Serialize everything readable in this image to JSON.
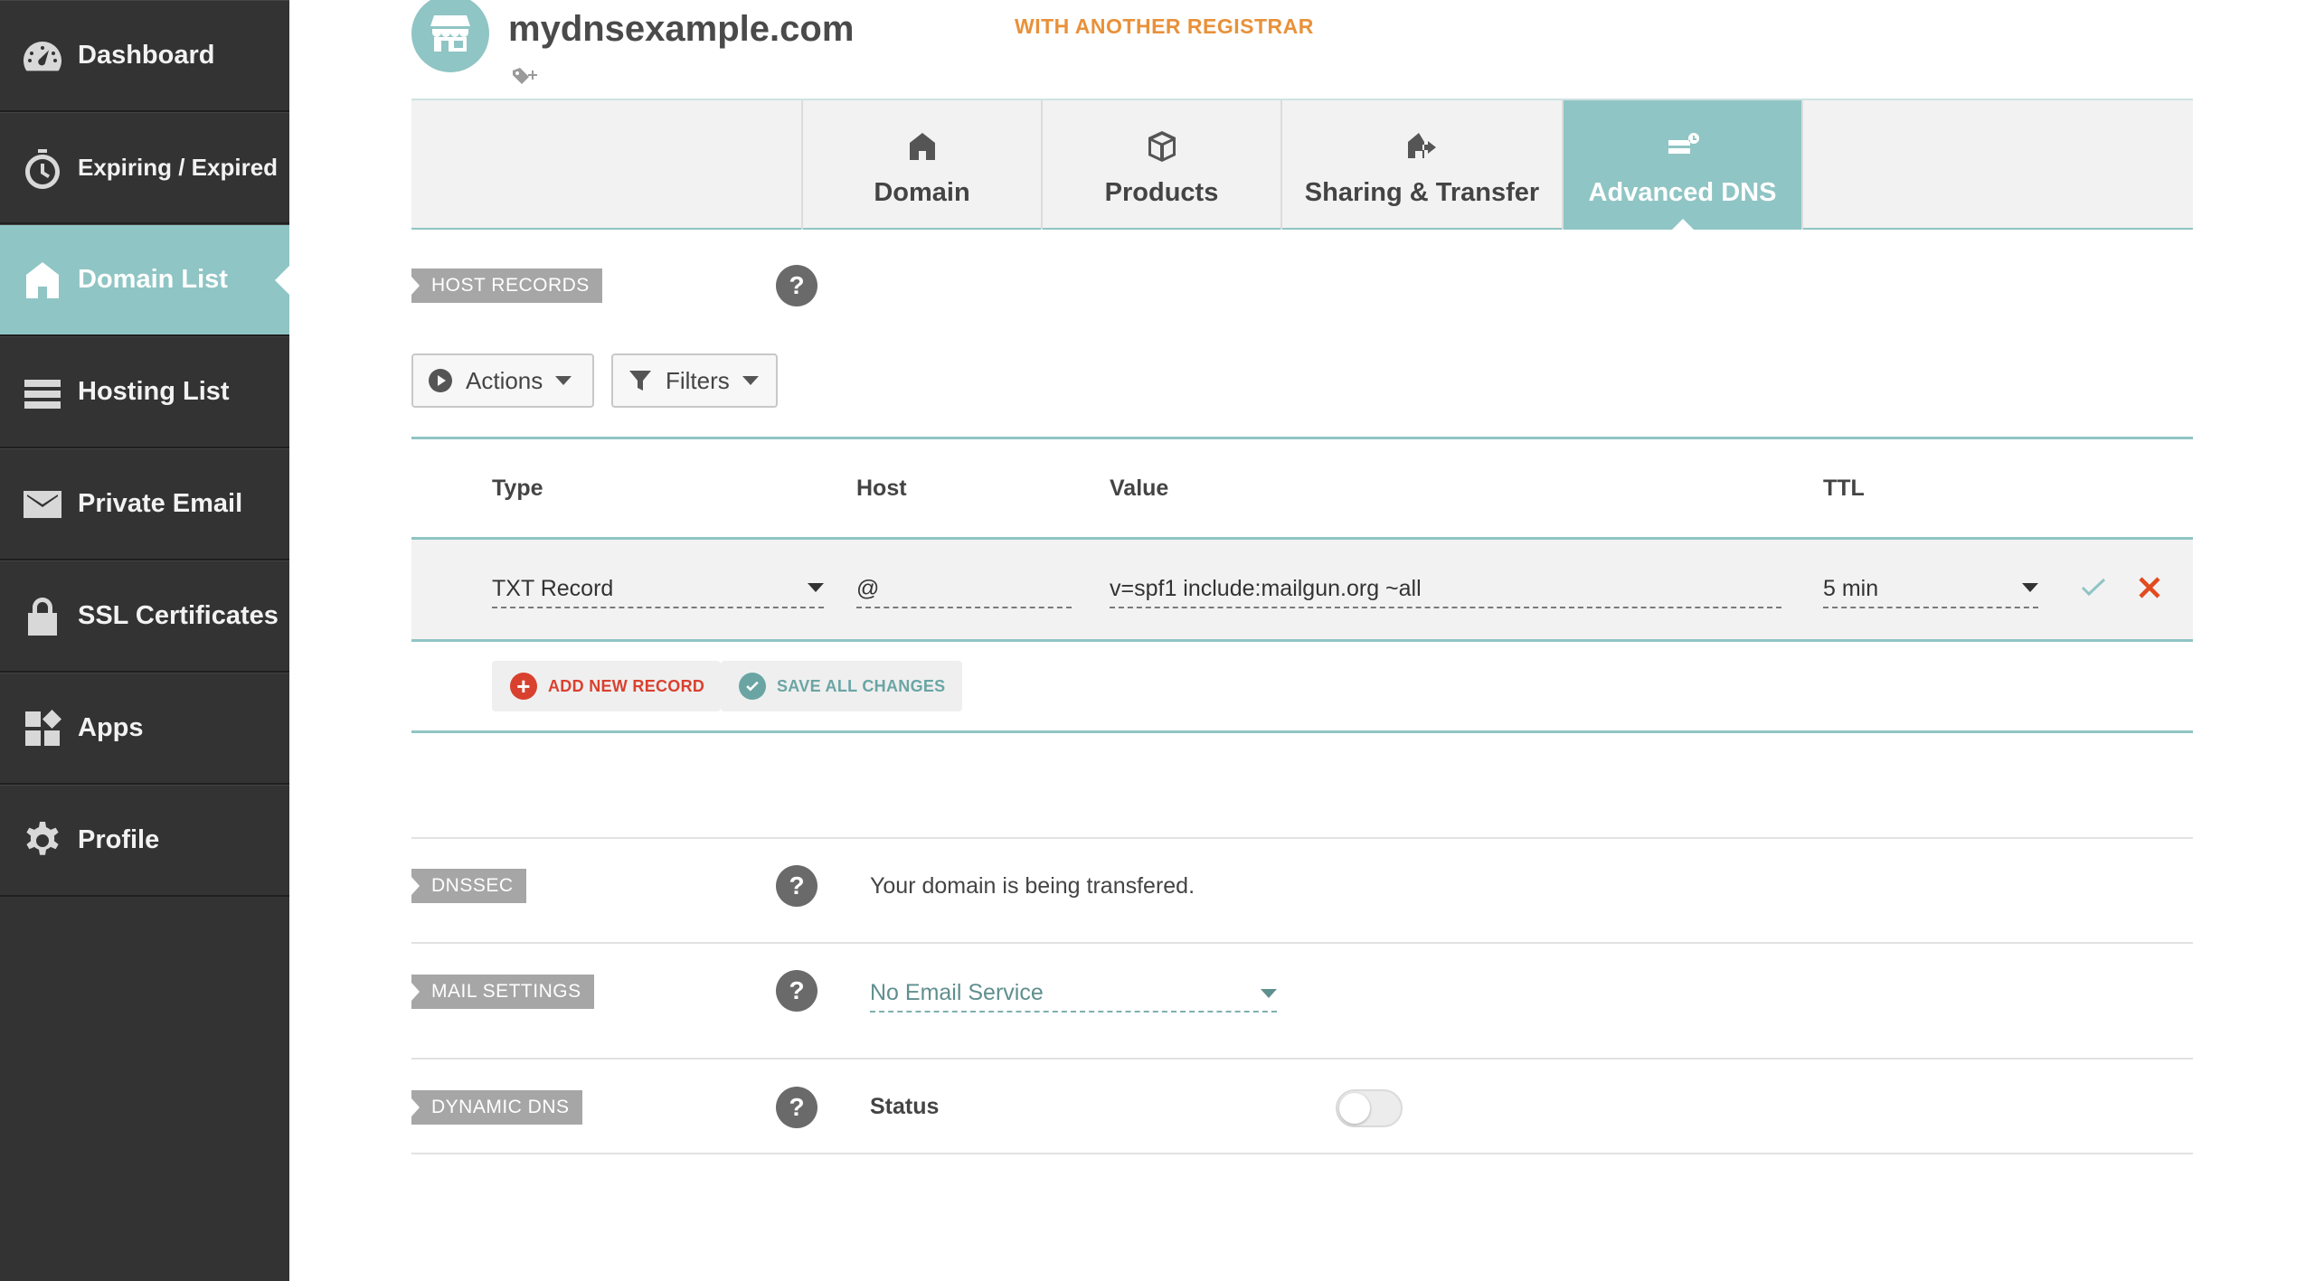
{
  "sidebar": {
    "items": [
      {
        "label": "Dashboard",
        "icon": "speedometer-icon",
        "active": false
      },
      {
        "label": "Expiring / Expired",
        "icon": "timer-icon",
        "active": false
      },
      {
        "label": "Domain List",
        "icon": "home-icon",
        "active": true
      },
      {
        "label": "Hosting List",
        "icon": "server-icon",
        "active": false
      },
      {
        "label": "Private Email",
        "icon": "envelope-icon",
        "active": false
      },
      {
        "label": "SSL Certificates",
        "icon": "lock-icon",
        "active": false
      },
      {
        "label": "Apps",
        "icon": "apps-grid-icon",
        "active": false
      },
      {
        "label": "Profile",
        "icon": "gear-icon",
        "active": false
      }
    ]
  },
  "domain": {
    "name": "mydnsexample.com",
    "registrar_badge": "WITH ANOTHER REGISTRAR"
  },
  "tabs": [
    {
      "label": "Domain",
      "icon": "home-icon",
      "active": false
    },
    {
      "label": "Products",
      "icon": "box-icon",
      "active": false
    },
    {
      "label": "Sharing & Transfer",
      "icon": "transfer-icon",
      "active": false
    },
    {
      "label": "Advanced DNS",
      "icon": "dns-server-icon",
      "active": true
    }
  ],
  "host_records": {
    "section_label": "HOST RECORDS",
    "actions_label": "Actions",
    "filters_label": "Filters",
    "columns": {
      "type": "Type",
      "host": "Host",
      "value": "Value",
      "ttl": "TTL"
    },
    "record": {
      "type": "TXT Record",
      "host": "@",
      "value": "v=spf1 include:mailgun.org ~all",
      "ttl": "5 min"
    },
    "add_new_label": "ADD NEW RECORD",
    "save_all_label": "SAVE ALL CHANGES"
  },
  "dnssec": {
    "section_label": "DNSSEC",
    "status_text": "Your domain is being transfered."
  },
  "mail_settings": {
    "section_label": "MAIL SETTINGS",
    "selected": "No Email Service"
  },
  "dynamic_dns": {
    "section_label": "DYNAMIC DNS",
    "status_label": "Status",
    "enabled": false
  },
  "help_symbol": "?",
  "colors": {
    "accent": "#8fc5c4",
    "sidebar_bg": "#333333",
    "registrar_orange": "#e8913a",
    "add_red": "#d9412f",
    "save_teal": "#6aa5a4",
    "delete_orange_red": "#e24a1f"
  }
}
